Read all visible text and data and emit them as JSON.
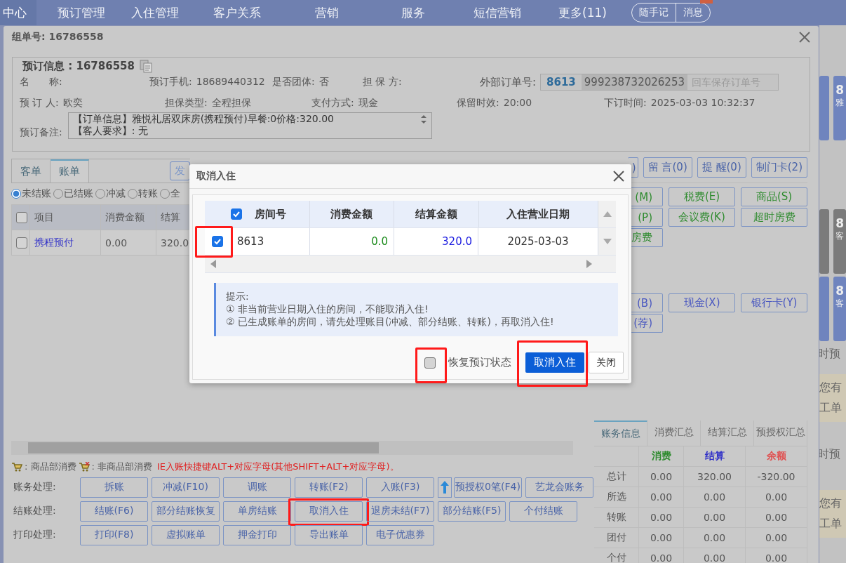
{
  "nav": {
    "items": [
      {
        "label": "中心",
        "selected": true
      },
      {
        "label": "预订管理",
        "selected": false
      },
      {
        "label": "入住管理",
        "selected": false
      },
      {
        "label": "客户关系",
        "selected": false
      },
      {
        "label": "营销",
        "selected": false
      },
      {
        "label": "服务",
        "selected": false
      },
      {
        "label": "短信营销",
        "selected": false
      },
      {
        "label": "更多(11)",
        "selected": false
      }
    ],
    "buttons": [
      {
        "label": "随手记",
        "badge": false
      },
      {
        "label": "消息",
        "badge": true
      }
    ]
  },
  "side_panel": [
    {
      "kind": "tile",
      "color": "#6f84be",
      "lines": [
        "8",
        "雅"
      ]
    },
    {
      "kind": "tile",
      "color": "#7b7b7b",
      "lines": [
        "8",
        "客"
      ]
    },
    {
      "kind": "tile",
      "color": "#6f84be",
      "lines": [
        "8",
        "客"
      ]
    },
    {
      "kind": "alert",
      "text": "时预"
    },
    {
      "kind": "note",
      "lines": [
        "您有",
        "工单"
      ]
    },
    {
      "kind": "alert",
      "text": "时预"
    },
    {
      "kind": "note",
      "lines": [
        "您有",
        "工单"
      ]
    }
  ],
  "order_window": {
    "title": "组单号: 16786558",
    "booking": {
      "legend": "预订信息 : 16786558",
      "rows": [
        [
          {
            "label": "名　　称:"
          },
          {
            "label": "预订手机:",
            "value": "18689440312"
          },
          {
            "label": "是否团体:",
            "value": "否"
          },
          {
            "label": "担 保 方:"
          }
        ],
        [
          {
            "label": "预 订 人:",
            "value": "欧奕"
          },
          {
            "label": "担保类型:",
            "value": "全程担保"
          },
          {
            "label": "支付方式:",
            "value": "现金"
          },
          {
            "label": "保留时效:",
            "value": "20:00"
          },
          {
            "label": "下订时间:",
            "value": "2025-03-03 10:32:37"
          }
        ]
      ],
      "external_order": {
        "label": "外部订单号:",
        "code": "8613",
        "number": "999238732026253",
        "placeholder": "回车保存订单号"
      },
      "remark": {
        "label": "预订备注:",
        "lines": [
          "【订单信息】雅悦礼居双床房(携程预付)早餐:0价格:320.00",
          "【客人要求】: 无"
        ]
      }
    },
    "tabs": [
      {
        "label": "客单",
        "selected": false
      },
      {
        "label": "账单",
        "selected": true
      }
    ],
    "tab_button": "发",
    "top_buttons": [
      ")",
      "留 言(0)",
      "提 醒(0)",
      "制门卡(2)"
    ],
    "filters": [
      {
        "label": "未结账",
        "selected": true
      },
      {
        "label": "已结账",
        "selected": false
      },
      {
        "label": "冲减",
        "selected": false
      },
      {
        "label": "转账",
        "selected": false
      },
      {
        "label": "全",
        "selected": false
      }
    ],
    "bill_table": {
      "checked": false,
      "columns": [
        "项目",
        "消费金额",
        "结算"
      ],
      "rows": [
        {
          "checked": false,
          "cells": [
            "携程预付",
            "0.00",
            "320.0"
          ]
        }
      ]
    },
    "entry_buttons": [
      "(M)",
      "税费(E)",
      "商品(S)",
      "(P)",
      "会议费(K)",
      "超时房费",
      "房费"
    ],
    "payment_buttons": [
      "(B)",
      "现金(X)",
      "银行卡(Y)",
      "(荐)"
    ],
    "legend": {
      "goods": ": 商品部消费",
      "non_goods": ": 非商品部消费",
      "hint": "IE入账快捷键ALT+对应字母(其他SHIFT+ALT+对应字母)。"
    },
    "action_groups": [
      {
        "label": "账务处理:",
        "buttons": [
          {
            "kind": "button",
            "label": "拆账"
          },
          {
            "kind": "button",
            "label": "冲减(F10)"
          },
          {
            "kind": "button",
            "label": "调账"
          },
          {
            "kind": "button",
            "label": "转账(F2)"
          },
          {
            "kind": "button",
            "label": "入账(F3)"
          },
          {
            "kind": "arrow"
          },
          {
            "kind": "button",
            "label": "预授权0笔(F4)"
          },
          {
            "kind": "button",
            "label": "艺龙会账务"
          }
        ]
      },
      {
        "label": "结账处理:",
        "buttons": [
          {
            "kind": "button",
            "label": "结账(F6)"
          },
          {
            "kind": "button",
            "label": "部分结账恢复"
          },
          {
            "kind": "button",
            "label": "单房结账"
          },
          {
            "kind": "button",
            "label": "取消入住",
            "highlighted": true
          },
          {
            "kind": "button",
            "label": "退房未结(F7)"
          },
          {
            "kind": "button",
            "label": "部分结账(F5)"
          },
          {
            "kind": "button",
            "label": "个付结账"
          }
        ]
      },
      {
        "label": "打印处理:",
        "buttons": [
          {
            "kind": "button",
            "label": "打印(F8)"
          },
          {
            "kind": "button",
            "label": "虚拟账单"
          },
          {
            "kind": "button",
            "label": "押金打印"
          },
          {
            "kind": "button",
            "label": "导出账单"
          },
          {
            "kind": "button",
            "label": "电子优惠券"
          }
        ]
      }
    ],
    "summary": {
      "tabs": [
        {
          "label": "账务信息",
          "selected": true
        },
        {
          "label": "消费汇总",
          "selected": false
        },
        {
          "label": "结算汇总",
          "selected": false
        },
        {
          "label": "预授权汇总",
          "selected": false
        }
      ],
      "columns": [
        {
          "kind": "corner"
        },
        {
          "kind": "header",
          "label": "消费",
          "color": "#2e8b2e"
        },
        {
          "kind": "header",
          "label": "结算",
          "color": "#3030c8"
        },
        {
          "kind": "header",
          "label": "余额",
          "color": "#e05050"
        }
      ],
      "rows": [
        [
          "总计",
          "0.00",
          "320.00",
          "-320.00"
        ],
        [
          "所选",
          "0.00",
          "0.00",
          "0.00"
        ],
        [
          "转账",
          "0.00",
          "0.00",
          "0.00"
        ],
        [
          "团付",
          "0.00",
          "0.00",
          "0.00"
        ],
        [
          "个付",
          "0.00",
          "0.00",
          "0.00"
        ]
      ]
    }
  },
  "dialog": {
    "title": "取消入住",
    "header_checked": true,
    "columns": [
      "房间号",
      "消费金额",
      "结算金额",
      "入住营业日期"
    ],
    "rows": [
      {
        "checked": true,
        "highlighted": true,
        "room": "8613",
        "consumption": "0.0",
        "settlement": "320.0",
        "date": "2025-03-03"
      }
    ],
    "tip": {
      "title": "提示:",
      "lines": [
        "① 非当前营业日期入住的房间，不能取消入住!",
        "② 已生成账单的房间，请先处理账目(冲减、部分结账、转账)，再取消入住!"
      ]
    },
    "restore": {
      "label": "恢复预订状态",
      "checked": false,
      "highlighted": true
    },
    "confirm": {
      "label": "取消入住",
      "highlighted": true
    },
    "close": "关闭"
  }
}
